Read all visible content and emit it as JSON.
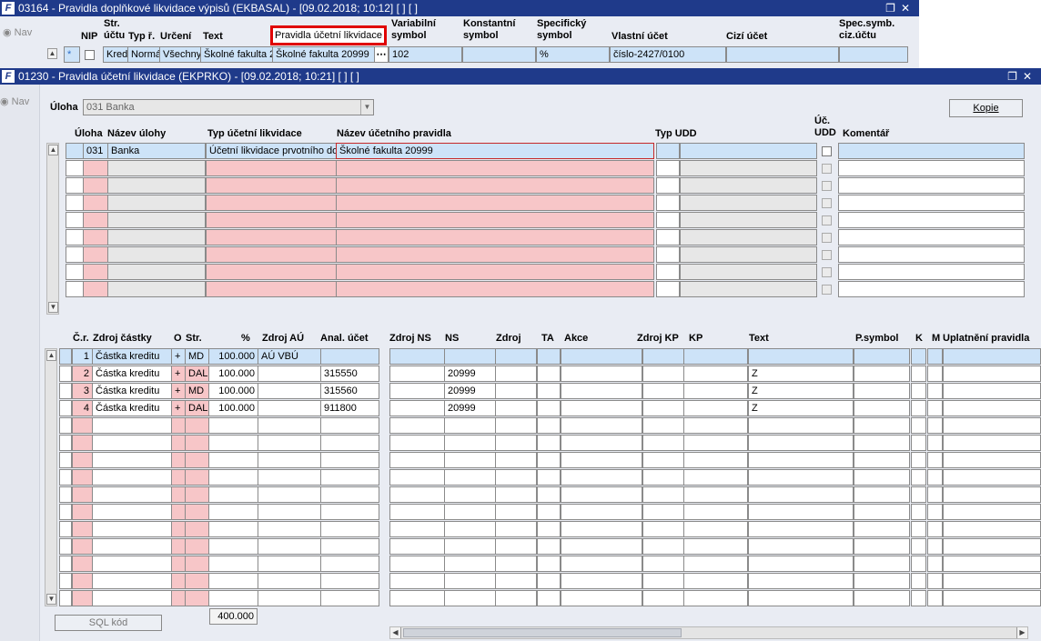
{
  "back_window": {
    "title": "03164 - Pravidla doplňkové likvidace výpisů (EKBASAL) - [09.02.2018; 10:12]  [ ]  [ ]",
    "nav_label": "Nav",
    "headers": {
      "nip": "NIP",
      "str_uctu": "Str. účtu",
      "typ_r": "Typ ř.",
      "urceni": "Určení",
      "text": "Text",
      "pravidla": "Pravidla účetní likvidace",
      "variabilni": "Variabilní symbol",
      "konstantni": "Konstantní symbol",
      "specificky": "Specifický symbol",
      "vlastni_ucet": "Vlastní účet",
      "cizi_ucet": "Cizí účet",
      "spec_symb": "Spec.symb. ciz.účtu"
    },
    "row": {
      "str_uctu": "Kred",
      "typ_r": "Normá",
      "urceni": "Všechny",
      "text": "Školné fakulta 2",
      "pravidla": "Školné fakulta 20999",
      "variabilni": "102",
      "konstantni": "",
      "specificky": "%",
      "vlastni_ucet": "číslo-2427/0100",
      "cizi_ucet": "",
      "spec_symb": ""
    }
  },
  "front_window": {
    "title": "01230 - Pravidla účetní likvidace (EKPRKO) - [09.02.2018; 10:21]  [ ]  [ ]",
    "nav_label": "Nav",
    "uloha_label": "Úloha",
    "uloha_value": "031 Banka",
    "kopie_button": "Kopie",
    "sql_button": "SQL kód",
    "total": "400.000",
    "upper_headers": {
      "uloha": "Úloha",
      "nazev_ulohy": "Název úlohy",
      "typ_likv": "Typ účetní likvidace",
      "nazev_pravidla": "Název účetního pravidla",
      "typ_udd": "Typ UDD",
      "uc_udd": "Úč. UDD",
      "komentar": "Komentář"
    },
    "upper_row": {
      "uloha": "031",
      "nazev_ulohy": "Banka",
      "typ_likv": "Účetní likvidace prvotního do",
      "nazev_pravidla": "Školné fakulta 20999"
    },
    "lower_headers": {
      "cr": "Č.r.",
      "zdroj_castky": "Zdroj částky",
      "o": "O",
      "str": "Str.",
      "pct": "%",
      "zdroj_au": "Zdroj AÚ",
      "anal_ucet": "Anal. účet",
      "zdroj_ns": "Zdroj NS",
      "ns": "NS",
      "zdroj": "Zdroj",
      "ta": "TA",
      "akce": "Akce",
      "zdroj_kp": "Zdroj KP",
      "kp": "KP",
      "text": "Text",
      "psymbol": "P.symbol",
      "k": "K",
      "m": "M",
      "uplatneni": "Uplatnění pravidla"
    },
    "lower_rows": [
      {
        "cr": "1",
        "zdroj": "Částka kreditu",
        "o": "+",
        "str": "MD",
        "pct": "100.000",
        "zdroj_au": "AÚ VBÚ",
        "anal": "",
        "ns": "",
        "text": ""
      },
      {
        "cr": "2",
        "zdroj": "Částka kreditu",
        "o": "+",
        "str": "DAL",
        "pct": "100.000",
        "zdroj_au": "",
        "anal": "315550",
        "ns": "20999",
        "text": "Z"
      },
      {
        "cr": "3",
        "zdroj": "Částka kreditu",
        "o": "+",
        "str": "MD",
        "pct": "100.000",
        "zdroj_au": "",
        "anal": "315560",
        "ns": "20999",
        "text": "Z"
      },
      {
        "cr": "4",
        "zdroj": "Částka kreditu",
        "o": "+",
        "str": "DAL",
        "pct": "100.000",
        "zdroj_au": "",
        "anal": "911800",
        "ns": "20999",
        "text": "Z"
      }
    ]
  },
  "colors": {
    "title_bar": "#1f3a8a",
    "highlight_red": "#e00000",
    "row_blue": "#cde3f8",
    "required_pink": "#f7c6c8"
  }
}
